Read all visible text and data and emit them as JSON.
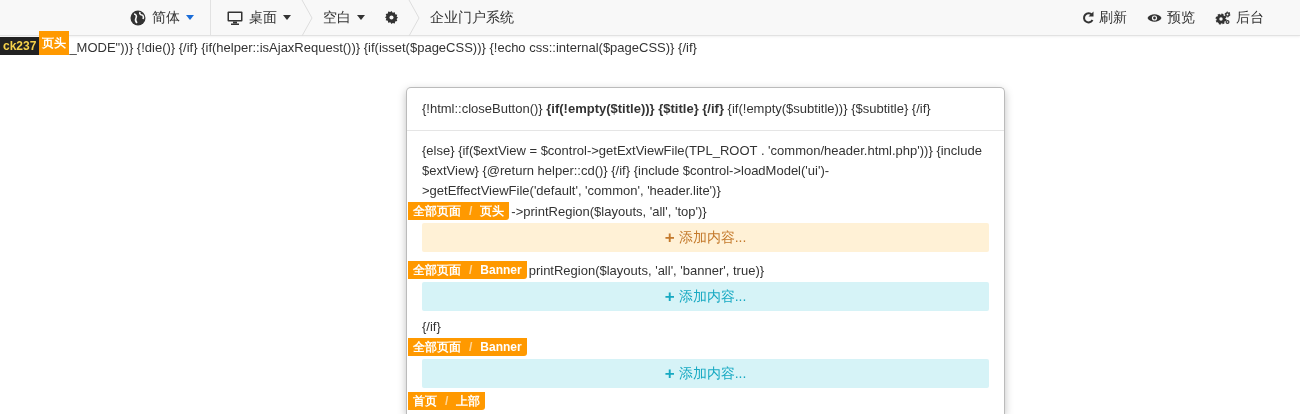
{
  "navbar": {
    "left": [
      {
        "kind": "language",
        "label": "简体",
        "caret": true
      },
      {
        "kind": "divider"
      },
      {
        "kind": "device",
        "label": "桌面",
        "caret": true
      },
      {
        "kind": "chevron"
      },
      {
        "kind": "layout",
        "label": "空白",
        "caret": true
      },
      {
        "kind": "settings"
      },
      {
        "kind": "chevron"
      },
      {
        "kind": "site",
        "label": "企业门户系统"
      }
    ],
    "right": [
      {
        "kind": "refresh",
        "label": "刷新"
      },
      {
        "kind": "preview",
        "label": "预览"
      },
      {
        "kind": "admin",
        "label": "后台"
      }
    ]
  },
  "code_line": {
    "tags": [
      {
        "kind": "block",
        "text": "ck237"
      },
      {
        "kind": "region",
        "text": "页头"
      }
    ],
    "text": "_MODE\"))} {!die()} {/if} {if(helper::isAjaxRequest())} {if(isset($pageCSS))} {!echo css::internal($pageCSS)} {/if}"
  },
  "modal": {
    "header": "{!html::closeButton()} **{if(!empty($title))} {$title} {/if}** {if(!empty($subtitle))} {$subtitle} {/if}",
    "body": [
      {
        "kind": "code",
        "text": "{else} {if($extView = $control->getExtViewFile(TPL_ROOT . 'common/header.html.php'))} {include"
      },
      {
        "kind": "code",
        "text": "$extView} {@return helper::cd()} {/if} {include $control->loadModel('ui')-"
      },
      {
        "kind": "code",
        "text": ">getEffectViewFile('default', 'common', 'header.lite')}"
      },
      {
        "kind": "region",
        "path": [
          "全部页面",
          "页头"
        ],
        "separator": "/",
        "text": "->printRegion($layouts, 'all', 'top')}"
      },
      {
        "kind": "warning",
        "icon": "+",
        "label": "添加内容..."
      },
      {
        "kind": "region",
        "path": [
          "全部页面",
          "Banner"
        ],
        "separator": "/",
        "text": "printRegion($layouts, 'all', 'banner', true)}"
      },
      {
        "kind": "info",
        "icon": "+",
        "label": "添加内容..."
      },
      {
        "kind": "code",
        "text": "{/if}"
      },
      {
        "kind": "region",
        "path": [
          "全部页面",
          "Banner"
        ],
        "separator": "/"
      },
      {
        "kind": "info",
        "icon": "+",
        "label": "添加内容..."
      },
      {
        "kind": "region",
        "path": [
          "首页",
          "上部"
        ],
        "separator": "/"
      }
    ]
  }
}
